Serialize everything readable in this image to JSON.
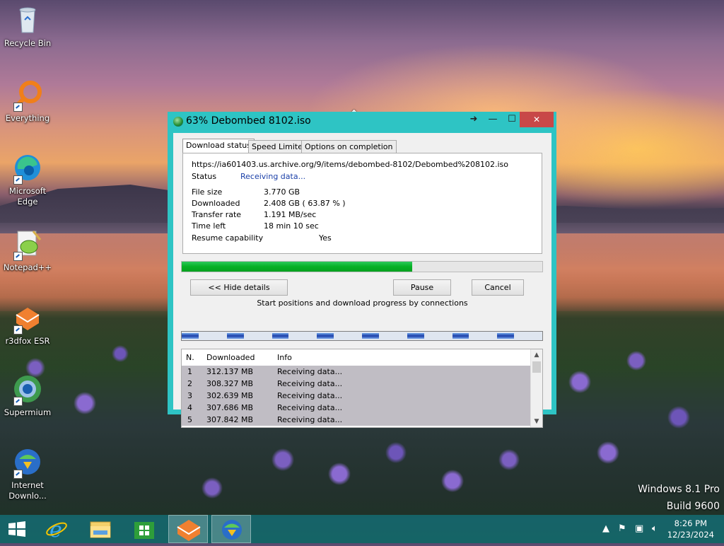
{
  "desktop": {
    "icons": [
      {
        "label": "Recycle Bin",
        "icon": "recycle-bin-icon"
      },
      {
        "label": "Everything",
        "icon": "everything-search-icon"
      },
      {
        "label": "Microsoft Edge",
        "icon": "edge-icon"
      },
      {
        "label": "Notepad++",
        "icon": "notepadpp-icon"
      },
      {
        "label": "r3dfox ESR",
        "icon": "r3dfox-icon"
      },
      {
        "label": "Supermium",
        "icon": "supermium-icon"
      },
      {
        "label": "Internet Downlo...",
        "icon": "idm-icon"
      }
    ],
    "watermark": {
      "line1": "Windows 8.1 Pro",
      "line2": "Build 9600"
    }
  },
  "window": {
    "title": "63% Debombed 8102.iso",
    "tabs": [
      "Download status",
      "Speed Limiter",
      "Options on completion"
    ],
    "active_tab": 0,
    "url": "https://ia601403.us.archive.org/9/items/debombed-8102/Debombed%208102.iso",
    "status_label": "Status",
    "status_value": "Receiving data...",
    "file_size_label": "File size",
    "file_size_value": "3.770  GB",
    "downloaded_label": "Downloaded",
    "downloaded_value": "2.408  GB  ( 63.87 % )",
    "transfer_rate_label": "Transfer rate",
    "transfer_rate_value": "1.191  MB/sec",
    "time_left_label": "Time left",
    "time_left_value": "18 min 10 sec",
    "resume_label": "Resume capability",
    "resume_value": "Yes",
    "progress_fraction": 0.6387,
    "buttons": {
      "hide_details": "<< Hide details",
      "pause": "Pause",
      "cancel": "Cancel"
    },
    "connections_caption": "Start positions and download progress by connections",
    "connections_progress": [
      0.75,
      0.0,
      0.75,
      0.0,
      0.75,
      0.0,
      0.75,
      0.0,
      0.75,
      0.0,
      0.75,
      0.0,
      0.75,
      0.0,
      0.75,
      0.0
    ],
    "list": {
      "headers": [
        "N.",
        "Downloaded",
        "Info"
      ],
      "rows": [
        {
          "n": "1",
          "downloaded": "312.137  MB",
          "info": "Receiving data..."
        },
        {
          "n": "2",
          "downloaded": "308.327  MB",
          "info": "Receiving data..."
        },
        {
          "n": "3",
          "downloaded": "302.639  MB",
          "info": "Receiving data..."
        },
        {
          "n": "4",
          "downloaded": "307.686  MB",
          "info": "Receiving data..."
        },
        {
          "n": "5",
          "downloaded": "307.842  MB",
          "info": "Receiving data..."
        }
      ]
    }
  },
  "taskbar": {
    "clock_time": "8:26 PM",
    "clock_date": "12/23/2024",
    "apps": [
      "start-icon",
      "internet-explorer-icon",
      "file-explorer-icon",
      "store-icon",
      "r3dfox-icon",
      "idm-icon"
    ]
  },
  "colors": {
    "titlebar": "#2ec4c4",
    "progress": "#06b025",
    "close": "#c84848"
  }
}
